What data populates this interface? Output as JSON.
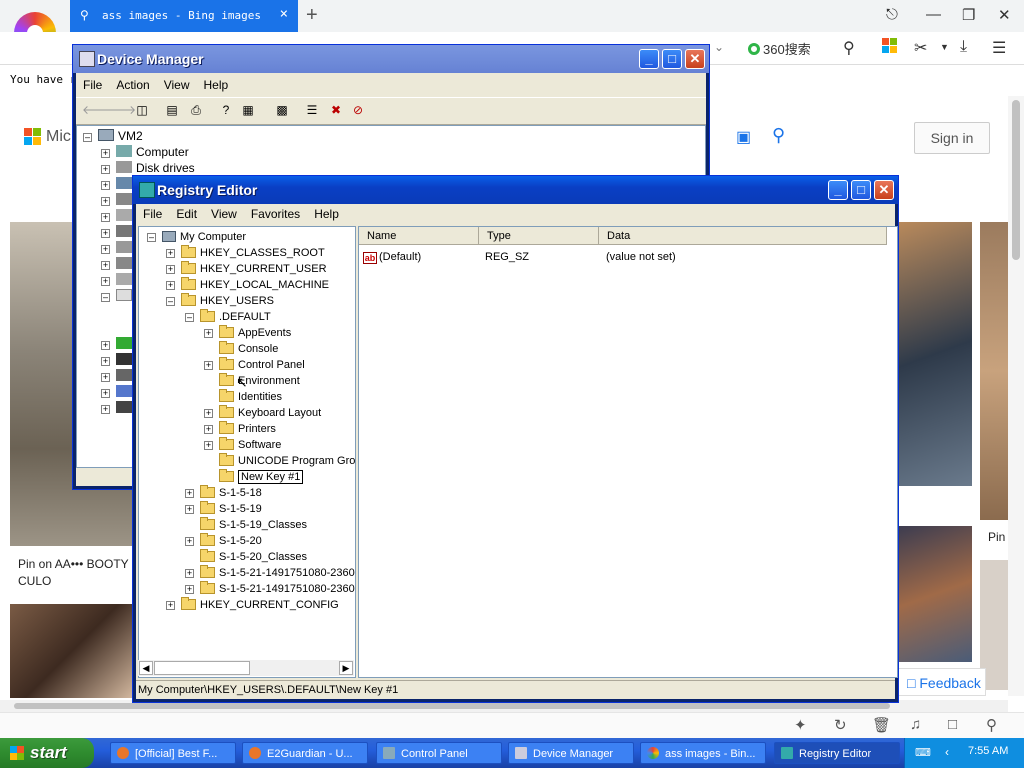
{
  "browser": {
    "tab_title": "ass images - Bing images",
    "new_tab": "+",
    "search_engine": "360搜索",
    "notice": "You have r",
    "ms_text": "Mic",
    "sign_in": "Sign in",
    "caption1": "Pin on AA••• BOOTY • CULO",
    "caption2": "Pin",
    "feedback": "Feedback"
  },
  "device_manager": {
    "title": "Device Manager",
    "menu": [
      "File",
      "Action",
      "View",
      "Help"
    ],
    "tree": {
      "root": "VM2",
      "items": [
        "Computer",
        "Disk drives"
      ]
    }
  },
  "registry_editor": {
    "title": "Registry Editor",
    "menu": [
      "File",
      "Edit",
      "View",
      "Favorites",
      "Help"
    ],
    "tree": {
      "root": "My Computer",
      "hives": [
        "HKEY_CLASSES_ROOT",
        "HKEY_CURRENT_USER",
        "HKEY_LOCAL_MACHINE",
        "HKEY_USERS"
      ],
      "default_key": ".DEFAULT",
      "default_children": [
        "AppEvents",
        "Console",
        "Control Panel",
        "Environment",
        "Identities",
        "Keyboard Layout",
        "Printers",
        "Software",
        "UNICODE Program Grou"
      ],
      "new_key": "New Key #1",
      "sids": [
        "S-1-5-18",
        "S-1-5-19",
        "S-1-5-19_Classes",
        "S-1-5-20",
        "S-1-5-20_Classes",
        "S-1-5-21-1491751080-2360",
        "S-1-5-21-1491751080-2360"
      ],
      "last_hive": "HKEY_CURRENT_CONFIG"
    },
    "columns": [
      "Name",
      "Type",
      "Data"
    ],
    "values": [
      {
        "name": "(Default)",
        "type": "REG_SZ",
        "data": "(value not set)"
      }
    ],
    "status": "My Computer\\HKEY_USERS\\.DEFAULT\\New Key #1"
  },
  "taskbar": {
    "start": "start",
    "tasks": [
      "[Official] Best F...",
      "E2Guardian - U...",
      "Control Panel",
      "Device Manager",
      "ass images - Bin...",
      "Registry Editor"
    ],
    "clock": "7:55 AM"
  }
}
